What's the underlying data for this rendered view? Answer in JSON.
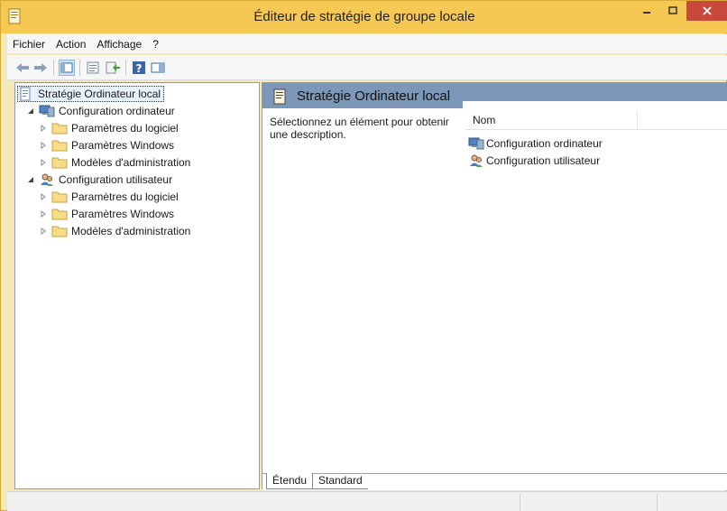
{
  "window": {
    "title": "Éditeur de stratégie de groupe locale",
    "icons": {
      "app": "policy-doc-icon",
      "minimize": "minimize-icon",
      "maximize": "maximize-icon",
      "close": "close-icon"
    },
    "colors": {
      "titlebar": "#f5c853",
      "close": "#c9483c",
      "header": "#7d97b8"
    }
  },
  "menu": [
    "Fichier",
    "Action",
    "Affichage",
    "?"
  ],
  "toolbar": [
    "back-arrow-icon",
    "forward-arrow-icon",
    "show-hide-tree-icon",
    "properties-icon",
    "export-list-icon",
    "help-icon",
    "show-hide-action-pane-icon"
  ],
  "tree": {
    "root": "Stratégie Ordinateur local",
    "computer": {
      "label": "Configuration ordinateur",
      "children": [
        "Paramètres du logiciel",
        "Paramètres Windows",
        "Modèles d'administration"
      ]
    },
    "user": {
      "label": "Configuration utilisateur",
      "children": [
        "Paramètres du logiciel",
        "Paramètres Windows",
        "Modèles d'administration"
      ]
    }
  },
  "details": {
    "title": "Stratégie Ordinateur local",
    "description": "Sélectionnez un élément pour obtenir une description.",
    "column_name": "Nom",
    "items": [
      "Configuration ordinateur",
      "Configuration utilisateur"
    ],
    "tabs": [
      "Étendu",
      "Standard"
    ]
  }
}
